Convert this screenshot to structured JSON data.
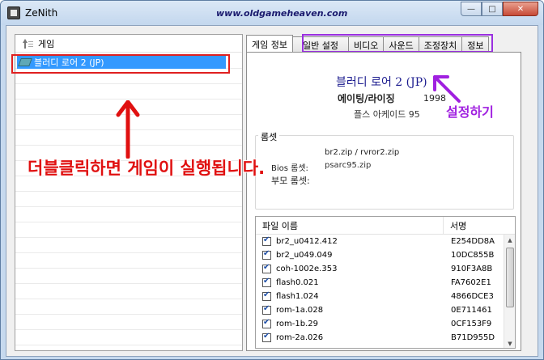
{
  "window": {
    "title": "ZeNith",
    "watermark": "www.oldgameheaven.com",
    "minimize_label": "—",
    "maximize_label": "□",
    "close_label": "✕"
  },
  "game_list": {
    "column_header": "게임",
    "selected_game": "블러디 로어 2 (JP)"
  },
  "tabs": [
    {
      "label": "게임 정보"
    },
    {
      "label": "일반 설정"
    },
    {
      "label": "비디오"
    },
    {
      "label": "사운드"
    },
    {
      "label": "조정장치"
    },
    {
      "label": "정보"
    }
  ],
  "game_info": {
    "title": "블러디 로어 2 (JP)",
    "company": "에이팅/라이징",
    "year": "1998",
    "platform": "플스 아케이드 95",
    "romset_label": "롬셋",
    "romset_line1": "br2.zip / rvror2.zip",
    "romset_line2_label": "Bios 롬셋:",
    "romset_line2_value": "psarc95.zip",
    "romset_line3_label": "부모 롬셋:",
    "romset_line3_value": ""
  },
  "file_table": {
    "col_name": "파일 이름",
    "col_sig": "서명",
    "rows": [
      {
        "name": "br2_u0412.412",
        "sig": "E254DD8A"
      },
      {
        "name": "br2_u049.049",
        "sig": "10DC855B"
      },
      {
        "name": "coh-1002e.353",
        "sig": "910F3A8B"
      },
      {
        "name": "flash0.021",
        "sig": "FA7602E1"
      },
      {
        "name": "flash1.024",
        "sig": "4866DCE3"
      },
      {
        "name": "rom-1a.028",
        "sig": "0E711461"
      },
      {
        "name": "rom-1b.29",
        "sig": "0CF153F9"
      },
      {
        "name": "rom-2a.026",
        "sig": "B71D955D"
      }
    ]
  },
  "annotations": {
    "caption": "더블클릭하면 게임이 실행됩니다.",
    "setup_label": "설정하기",
    "red": "#e01010",
    "purple": "#a020e0"
  }
}
